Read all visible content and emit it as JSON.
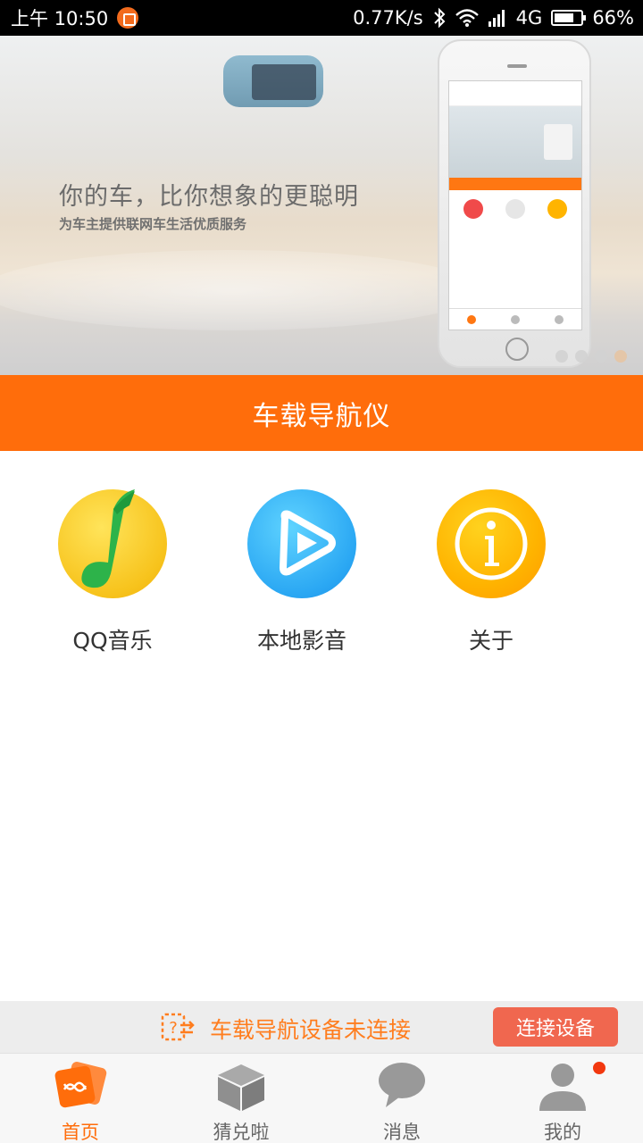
{
  "status_bar": {
    "time": "上午 10:50",
    "net_speed": "0.77K/s",
    "network": "4G",
    "battery": "66%",
    "battery_level": 0.66,
    "icons": [
      "notification-icon",
      "bluetooth-icon",
      "wifi-icon",
      "signal-icon",
      "battery-icon"
    ]
  },
  "banner": {
    "title": "你的车，比你想象的更聪明",
    "subtitle": "为车主提供联网车生活优质服务",
    "slide_count": 4,
    "active_slide": 4
  },
  "section": {
    "title": "车载导航仪"
  },
  "apps": [
    {
      "label": "QQ音乐",
      "icon": "qq-music-icon"
    },
    {
      "label": "本地影音",
      "icon": "local-video-icon"
    },
    {
      "label": "关于",
      "icon": "about-info-icon"
    }
  ],
  "notice": {
    "text": "车载导航设备未连接",
    "button": "连接设备",
    "icon": "device-disconnected-icon"
  },
  "tabs": [
    {
      "label": "首页",
      "icon": "home-icon",
      "active": true
    },
    {
      "label": "猜兑啦",
      "icon": "box-icon",
      "active": false
    },
    {
      "label": "消息",
      "icon": "chat-bubble-icon",
      "active": false
    },
    {
      "label": "我的",
      "icon": "person-icon",
      "active": false,
      "badge": true
    }
  ],
  "colors": {
    "accent": "#ff6d0b",
    "button": "#f0674f",
    "notice_text": "#ff7d1e",
    "badge": "#f2380f"
  }
}
